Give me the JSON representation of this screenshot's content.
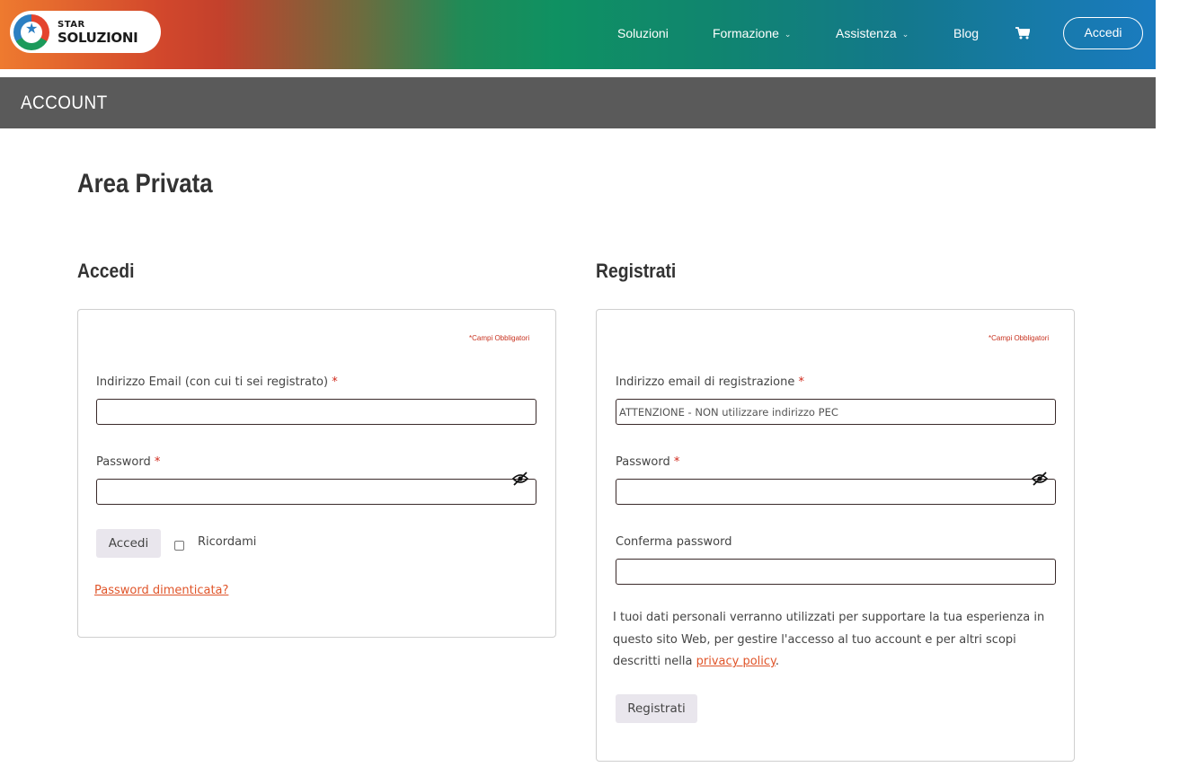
{
  "header": {
    "logo_top": "STAR",
    "logo_bottom": "SOLUZIONI",
    "nav": [
      {
        "label": "Soluzioni"
      },
      {
        "label": "Formazione"
      },
      {
        "label": "Assistenza"
      },
      {
        "label": "Blog"
      }
    ],
    "login_label": "Accedi"
  },
  "account_bar": {
    "title": "ACCOUNT"
  },
  "page_title": "Area Privata",
  "login": {
    "title": "Accedi",
    "required_note": "*Campi Obbligatori",
    "email_label": "Indirizzo Email (con cui ti sei registrato)",
    "email_value": "",
    "password_label": "Password",
    "password_value": "",
    "submit_label": "Accedi",
    "remember_label": "Ricordami",
    "forgot_label": "Password dimenticata?"
  },
  "register": {
    "title": "Registrati",
    "required_note": "*Campi Obbligatori",
    "email_label": "Indirizzo email di registrazione",
    "email_placeholder": "ATTENZIONE - NON utilizzare indirizzo PEC",
    "password_label": "Password",
    "confirm_label": "Conferma password",
    "privacy_text_1": "I tuoi dati personali verranno utilizzati per supportare la tua esperienza in questo sito Web, per gestire l'accesso al tuo account e per altri scopi descritti nella ",
    "privacy_link": "privacy policy",
    "privacy_text_2": ".",
    "submit_label": "Registrati"
  },
  "required_mark": "*",
  "colors": {
    "account_bar": "#5a5a5a",
    "link": "#e0552a",
    "required": "#d0281b",
    "button_bg": "#e9e6ed"
  },
  "icons": [
    "star-logo-icon",
    "chevron-down-icon",
    "cart-icon",
    "eye-slash-icon"
  ]
}
